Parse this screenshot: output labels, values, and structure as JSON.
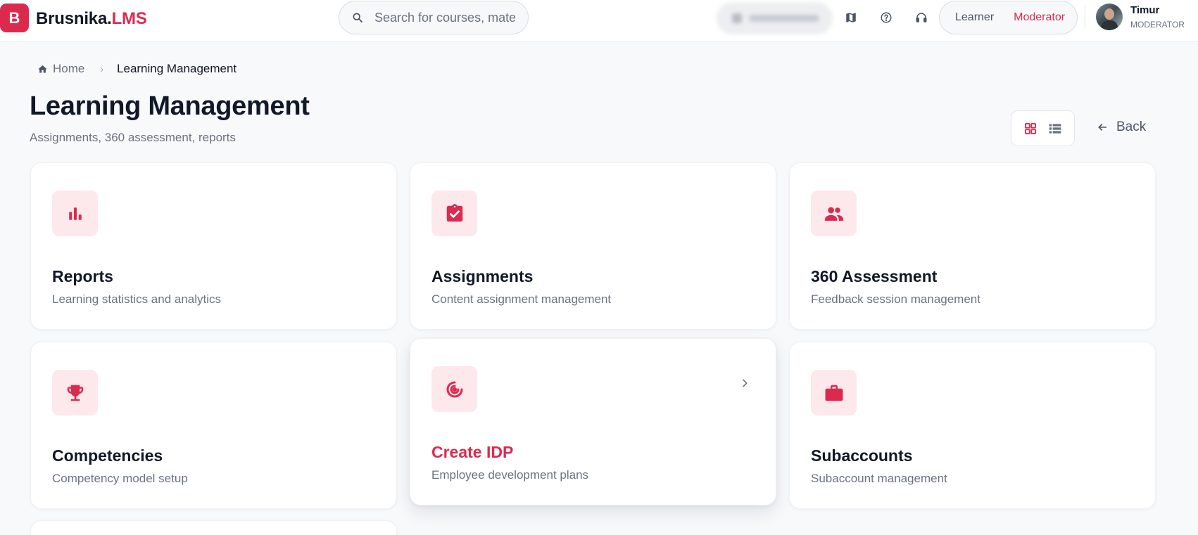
{
  "brand": {
    "mark": "B",
    "name": "Brusnika.",
    "accent": "LMS",
    "accent_color": "#dc2a4f"
  },
  "search": {
    "placeholder": "Search for courses, materi",
    "icon": "search-icon"
  },
  "header_icons": [
    "map-icon",
    "help-circle-icon",
    "headset-icon"
  ],
  "roles": {
    "learner": "Learner",
    "moderator": "Moderator",
    "active": "Moderator"
  },
  "user": {
    "name": "Timur",
    "role": "MODERATOR"
  },
  "breadcrumb": {
    "home": "Home",
    "current": "Learning Management"
  },
  "page": {
    "title": "Learning Management",
    "subtitle": "Assignments, 360 assessment, reports",
    "back": "Back"
  },
  "view_modes": {
    "active": "grid",
    "options": [
      "grid",
      "list"
    ]
  },
  "cards": [
    {
      "title": "Reports",
      "desc": "Learning statistics and analytics",
      "icon": "bar-chart-icon"
    },
    {
      "title": "Assignments",
      "desc": "Content assignment management",
      "icon": "clipboard-check-icon"
    },
    {
      "title": "360 Assessment",
      "desc": "Feedback session management",
      "icon": "people-icon"
    },
    {
      "title": "Competencies",
      "desc": "Competency model setup",
      "icon": "trophy-icon"
    },
    {
      "title": "Create IDP",
      "desc": "Employee development plans",
      "icon": "target-icon",
      "hovered": true
    },
    {
      "title": "Subaccounts",
      "desc": "Subaccount management",
      "icon": "briefcase-icon"
    }
  ]
}
